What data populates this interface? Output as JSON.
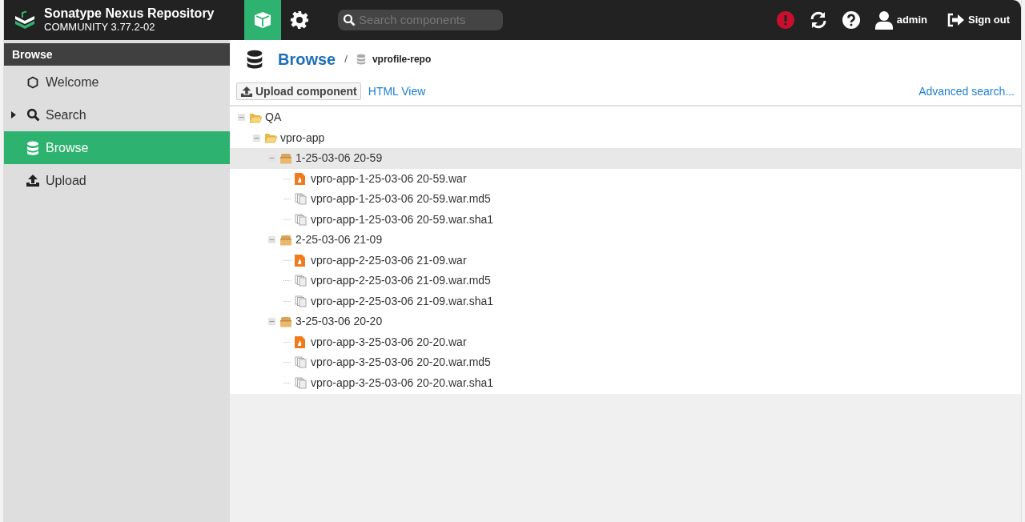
{
  "header": {
    "product": "Sonatype Nexus Repository",
    "edition": "COMMUNITY 3.77.2-02",
    "modes": [
      {
        "kind": "browse",
        "selected": true
      },
      {
        "kind": "admin",
        "selected": false
      }
    ],
    "search": {
      "placeholder": "Search components"
    },
    "user": "admin",
    "sign_out": "Sign out"
  },
  "sidebar": {
    "title": "Browse",
    "items": [
      {
        "label": "Welcome",
        "kind": "welcome",
        "selected": false,
        "expandable": false
      },
      {
        "label": "Search",
        "kind": "search",
        "selected": false,
        "expandable": true
      },
      {
        "label": "Browse",
        "kind": "browse",
        "selected": true,
        "expandable": false
      },
      {
        "label": "Upload",
        "kind": "upload",
        "selected": false,
        "expandable": false
      }
    ]
  },
  "breadcrumb": {
    "title": "Browse",
    "separator": "/",
    "repository": "vprofile-repo"
  },
  "toolbar": {
    "upload": "Upload component",
    "html_view": "HTML View",
    "advanced_search": "Advanced search..."
  },
  "tree": [
    {
      "label": "QA",
      "kind": "folder",
      "expanded": true,
      "selected": false,
      "children": [
        {
          "label": "vpro-app",
          "kind": "folder",
          "expanded": true,
          "selected": false,
          "children": [
            {
              "label": "1-25-03-06 20-59",
              "kind": "component",
              "expanded": true,
              "selected": true,
              "children": [
                {
                  "label": "vpro-app-1-25-03-06 20-59.war",
                  "kind": "war",
                  "selected": false
                },
                {
                  "label": "vpro-app-1-25-03-06 20-59.war.md5",
                  "kind": "file",
                  "selected": false
                },
                {
                  "label": "vpro-app-1-25-03-06 20-59.war.sha1",
                  "kind": "file",
                  "selected": false
                }
              ]
            },
            {
              "label": "2-25-03-06 21-09",
              "kind": "component",
              "expanded": true,
              "selected": false,
              "children": [
                {
                  "label": "vpro-app-2-25-03-06 21-09.war",
                  "kind": "war",
                  "selected": false
                },
                {
                  "label": "vpro-app-2-25-03-06 21-09.war.md5",
                  "kind": "file",
                  "selected": false
                },
                {
                  "label": "vpro-app-2-25-03-06 21-09.war.sha1",
                  "kind": "file",
                  "selected": false
                }
              ]
            },
            {
              "label": "3-25-03-06 20-20",
              "kind": "component",
              "expanded": true,
              "selected": false,
              "children": [
                {
                  "label": "vpro-app-3-25-03-06 20-20.war",
                  "kind": "war",
                  "selected": false
                },
                {
                  "label": "vpro-app-3-25-03-06 20-20.war.md5",
                  "kind": "file",
                  "selected": false
                },
                {
                  "label": "vpro-app-3-25-03-06 20-20.war.sha1",
                  "kind": "file",
                  "selected": false
                }
              ]
            }
          ]
        }
      ]
    }
  ]
}
